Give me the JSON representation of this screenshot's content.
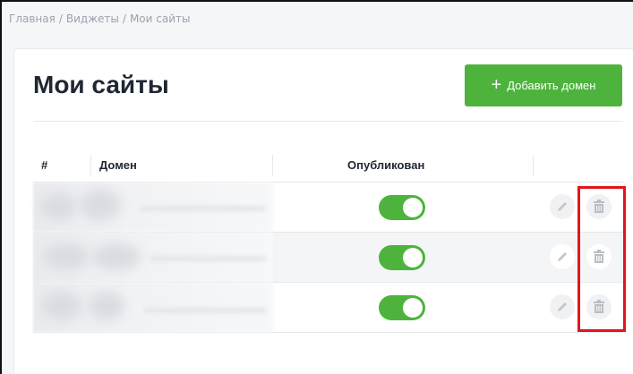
{
  "breadcrumb": {
    "items": [
      "Главная",
      "Виджеты",
      "Мои сайты"
    ],
    "separator": "/"
  },
  "page": {
    "title": "Мои сайты"
  },
  "actions": {
    "add_domain_label": "Добавить домен",
    "add_icon": "plus-icon"
  },
  "table": {
    "headers": {
      "index": "#",
      "domain": "Домен",
      "published": "Опубликован"
    },
    "rows": [
      {
        "published": true,
        "row_icons": [
          "pencil-icon",
          "trash-icon"
        ]
      },
      {
        "published": true,
        "row_icons": [
          "pencil-icon",
          "trash-icon"
        ]
      },
      {
        "published": true,
        "row_icons": [
          "pencil-icon",
          "trash-icon"
        ]
      }
    ]
  },
  "colors": {
    "accent_green": "#4db33d",
    "highlight_red": "#e4141b",
    "title_text": "#1f2733",
    "muted_text": "#9aa3ad"
  }
}
